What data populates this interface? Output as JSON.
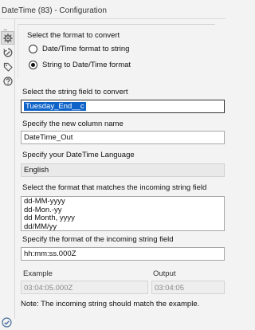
{
  "window": {
    "title": "DateTime (83) - Configuration"
  },
  "sidebar": {
    "more": "...",
    "icons": [
      "gear-icon",
      "annotation-icon",
      "tag-icon",
      "help-icon"
    ]
  },
  "convert_group": {
    "title": "Select the format to convert",
    "options": [
      {
        "label": "Date/Time format to string",
        "selected": false
      },
      {
        "label": "String to Date/Time format",
        "selected": true
      }
    ]
  },
  "string_field": {
    "label": "Select the string field to convert",
    "value": "Tuesday_End__c"
  },
  "new_column": {
    "label": "Specify the new column name",
    "value": "DateTime_Out"
  },
  "language": {
    "label": "Specify your DateTime Language",
    "value": "English"
  },
  "format_list": {
    "label": "Select the format that matches the incoming string field",
    "items": [
      "dd-MM-yyyy",
      "dd-Mon.-yy",
      "dd Month, yyyy",
      "dd/MM/yy"
    ]
  },
  "incoming_format": {
    "label": "Specify the format of the incoming string field",
    "value": "hh:mm:ss.000Z"
  },
  "example": {
    "label": "Example",
    "value": "03:04:05.000Z"
  },
  "output": {
    "label": "Output",
    "value": "03:04:05"
  },
  "note": "Note: The incoming string should match the example.",
  "colors": {
    "selection": "#0f63c8",
    "background": "#f3f3f3",
    "check": "#4a6fa0"
  }
}
